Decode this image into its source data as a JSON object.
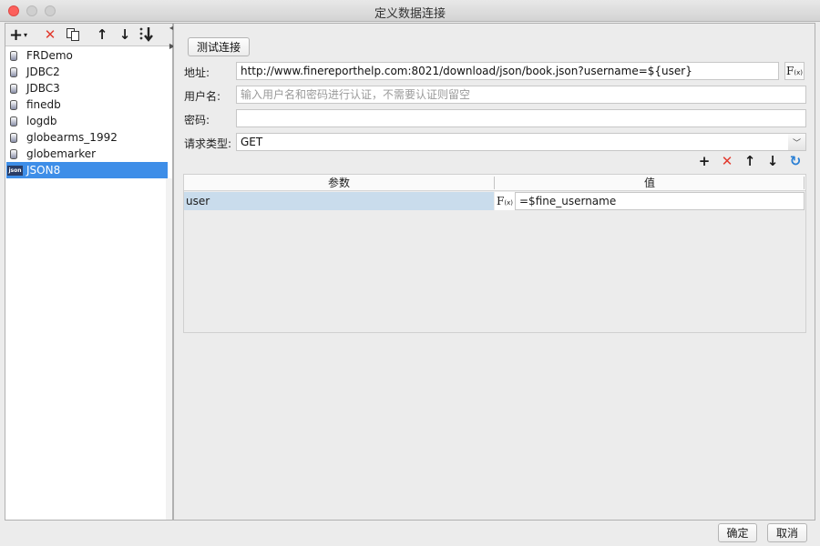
{
  "window": {
    "title": "定义数据连接"
  },
  "left_toolbar": {
    "add_icon": "+",
    "add_dropdown_icon": "▾",
    "delete_icon": "✕",
    "copy_icon": "copy",
    "move_up_icon": "↑",
    "move_down_icon": "↓",
    "sort_icon": "sort"
  },
  "connections": [
    {
      "label": "FRDemo",
      "icon": "database-icon"
    },
    {
      "label": "JDBC2",
      "icon": "database-icon"
    },
    {
      "label": "JDBC3",
      "icon": "database-icon"
    },
    {
      "label": "finedb",
      "icon": "database-icon"
    },
    {
      "label": "logdb",
      "icon": "database-icon"
    },
    {
      "label": "globearms_1992",
      "icon": "database-icon"
    },
    {
      "label": "globemarker",
      "icon": "database-icon"
    },
    {
      "label": "JSON8",
      "icon": "json-icon",
      "icon_text": "json",
      "selected": true
    }
  ],
  "form": {
    "test_button": "测试连接",
    "address_label": "地址:",
    "address_value": "http://www.finereporthelp.com:8021/download/json/book.json?username=${user}",
    "fx_label": "F",
    "fx_sub": "(x)",
    "username_label": "用户名:",
    "username_placeholder": "输入用户名和密码进行认证，不需要认证则留空",
    "password_label": "密码:",
    "password_value": "",
    "request_type_label": "请求类型:",
    "request_type_value": "GET"
  },
  "params_table": {
    "columns": [
      "参数",
      "值"
    ],
    "rows": [
      {
        "param": "user",
        "value": "=$fine_username"
      }
    ]
  },
  "footer": {
    "ok": "确定",
    "cancel": "取消"
  },
  "colors": {
    "selection": "#3e8ee8",
    "delete_red": "#e23a2e",
    "refresh_blue": "#2a7fd4",
    "row_highlight": "#c9dcec"
  }
}
